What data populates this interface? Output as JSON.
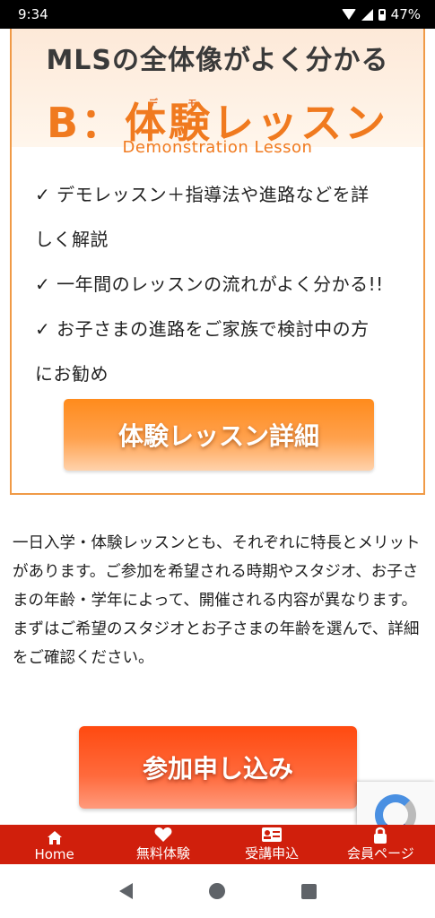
{
  "status_bar": {
    "time": "9:34",
    "battery": "47%"
  },
  "banner": {
    "line1": "MLSの全体像がよく分かる",
    "ruby_de": "デ",
    "ruby_mo": "モ",
    "line2": "B：体験レッスン",
    "subtitle": "Demonstration Lesson"
  },
  "features": [
    "✓ デモレッスン＋指導法や進路などを詳",
    "しく解説",
    "✓ 一年間のレッスンの流れがよく分かる!!",
    "✓ お子さまの進路をご家族で検討中の方",
    "にお勧め"
  ],
  "detail_button": {
    "label": "体験レッスン詳細"
  },
  "description": "一日入学・体験レッスンとも、それぞれに特長とメリットがあります。ご参加を希望される時期やスタジオ、お子さまの年齢・学年によって、開催される内容が異なります。まずはご希望のスタジオとお子さまの年齢を選んで、詳細をご確認ください。",
  "apply_button": {
    "label": "参加申し込み"
  },
  "bottom_nav": [
    {
      "label": "Home",
      "icon": "home-icon"
    },
    {
      "label": "無料体験",
      "icon": "heart-icon"
    },
    {
      "label": "受講申込",
      "icon": "id-card-icon"
    },
    {
      "label": "会員ページ",
      "icon": "lock-icon"
    }
  ],
  "colors": {
    "accent_orange": "#f07a1f",
    "nav_red": "#d01f0c",
    "apply_red": "#ff4a10"
  }
}
